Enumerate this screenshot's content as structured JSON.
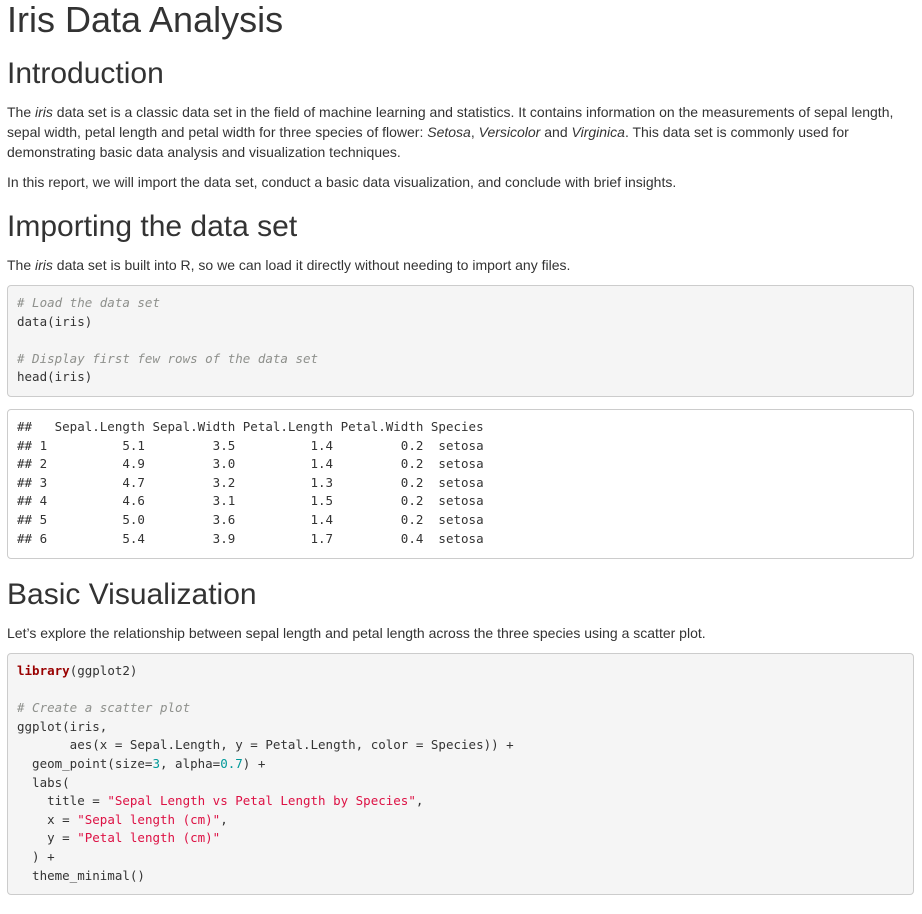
{
  "document": {
    "title": "Iris Data Analysis"
  },
  "introduction": {
    "heading": "Introduction",
    "p1_a": "The ",
    "p1_iris": "iris",
    "p1_b": " data set is a classic data set in the field of machine learning and statistics. It contains information on the measurements of sepal length, sepal width, petal length and petal width for three species of flower: ",
    "p1_setosa": "Setosa",
    "p1_c": ", ",
    "p1_versicolor": "Versicolor",
    "p1_d": " and ",
    "p1_virginica": "Virginica",
    "p1_e": ". This data set is commonly used for demonstrating basic data analysis and visualization techniques.",
    "p2": "In this report, we will import the data set, conduct a basic data visualization, and conclude with brief insights."
  },
  "importing": {
    "heading": "Importing the data set",
    "p_a": "The ",
    "p_iris": "iris",
    "p_b": " data set is built into R, so we can load it directly without needing to import any files.",
    "code": {
      "comment1": "# Load the data set",
      "line1": "data(iris)",
      "comment2": "# Display first few rows of the data set",
      "line2": "head(iris)"
    },
    "output": {
      "header": "##   Sepal.Length Sepal.Width Petal.Length Petal.Width Species",
      "rows": [
        "## 1          5.1         3.5          1.4         0.2  setosa",
        "## 2          4.9         3.0          1.4         0.2  setosa",
        "## 3          4.7         3.2          1.3         0.2  setosa",
        "## 4          4.6         3.1          1.5         0.2  setosa",
        "## 5          5.0         3.6          1.4         0.2  setosa",
        "## 6          5.4         3.9          1.7         0.4  setosa"
      ]
    }
  },
  "visualization": {
    "heading": "Basic Visualization",
    "p": "Let’s explore the relationship between sepal length and petal length across the three species using a scatter plot.",
    "code": {
      "kw_library": "library",
      "lib_arg": "(ggplot2)",
      "comment1": "# Create a scatter plot",
      "l_ggplot": "ggplot(iris,",
      "l_aes": "       aes(x = Sepal.Length, y = Petal.Length, color = Species)) +",
      "l_geom_a": "  geom_point(size=",
      "l_geom_size": "3",
      "l_geom_b": ", alpha=",
      "l_geom_alpha": "0.7",
      "l_geom_c": ") +",
      "l_labs": "  labs(",
      "l_title_a": "    title = ",
      "l_title_s": "\"Sepal Length vs Petal Length by Species\"",
      "l_title_b": ",",
      "l_x_a": "    x = ",
      "l_x_s": "\"Sepal length (cm)\"",
      "l_x_b": ",",
      "l_y_a": "    y = ",
      "l_y_s": "\"Petal length (cm)\"",
      "l_close": "  ) +",
      "l_theme": "  theme_minimal()"
    }
  }
}
